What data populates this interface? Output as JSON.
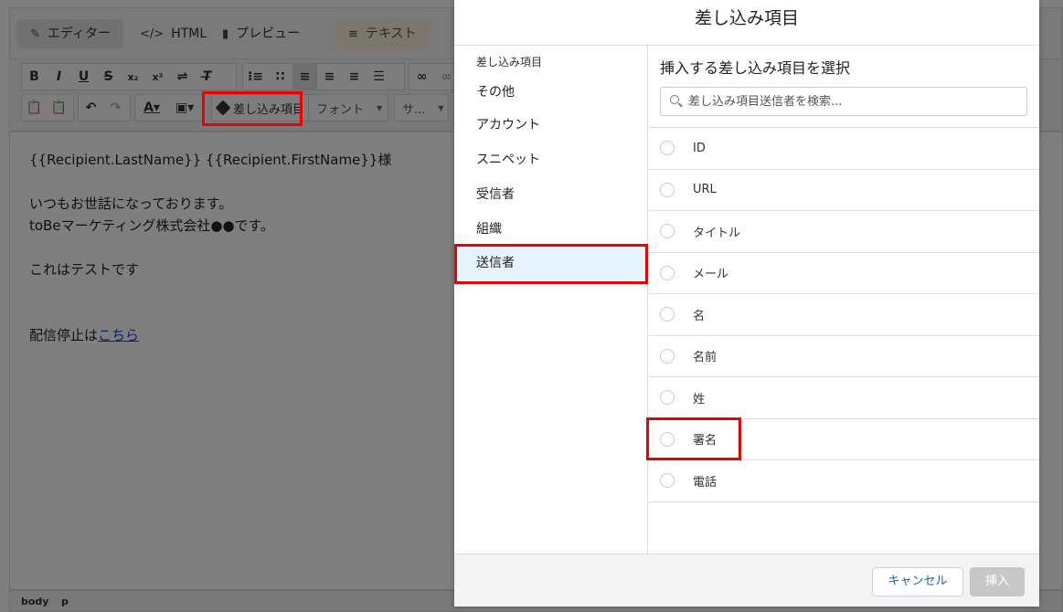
{
  "editor": {
    "tabs": [
      {
        "label": "エディター",
        "icon": "edit-icon"
      },
      {
        "label": "HTML",
        "icon": "code-icon"
      },
      {
        "label": "プレビュー",
        "icon": "document-icon"
      },
      {
        "label": "テキスト",
        "icon": "lines-icon"
      }
    ],
    "toolbar": {
      "merge_label": "差し込み項目",
      "font_label": "フォント",
      "size_label": "サ..."
    },
    "body_lines": [
      "{{Recipient.LastName}} {{Recipient.FirstName}}様",
      "",
      "いつもお世話になっております。",
      "toBeマーケティング株式会社●●です。",
      "",
      "これはテストです",
      "",
      "",
      "配信停止は"
    ],
    "unsubscribe_link": "こちら",
    "status_path": [
      "body",
      "p"
    ]
  },
  "modal": {
    "title": "差し込み項目",
    "categories_heading": "差し込み項目",
    "categories": [
      "その他",
      "アカウント",
      "スニペット",
      "受信者",
      "組織",
      "送信者"
    ],
    "selected_category": "送信者",
    "fields_heading": "挿入する差し込み項目を選択",
    "search_placeholder": "差し込み項目送信者を検索...",
    "fields": [
      "ID",
      "URL",
      "タイトル",
      "メール",
      "名",
      "名前",
      "姓",
      "署名",
      "電話"
    ],
    "cancel_label": "キャンセル",
    "insert_label": "挿入"
  },
  "colors": {
    "highlight": "#e00000",
    "selected_bg": "#e6f2fc",
    "link": "#1a3ed6"
  }
}
